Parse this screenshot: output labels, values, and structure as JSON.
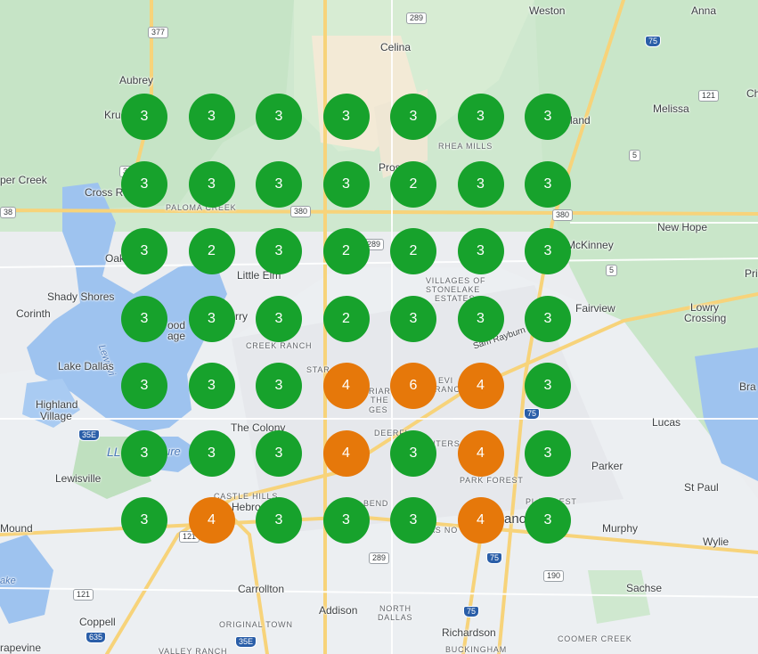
{
  "map": {
    "place_labels": [
      {
        "name": "Weston"
      },
      {
        "name": "Anna"
      },
      {
        "name": "Celina"
      },
      {
        "name": "Aubrey"
      },
      {
        "name": "Krug"
      },
      {
        "name": "land"
      },
      {
        "name": "Melissa"
      },
      {
        "name": "RHEA MILLS"
      },
      {
        "name": "per Creek"
      },
      {
        "name": "Cross Ro"
      },
      {
        "name": "Pros"
      },
      {
        "name": "PALOMA CREEK"
      },
      {
        "name": "New Hope"
      },
      {
        "name": "McKinney"
      },
      {
        "name": "Oak"
      },
      {
        "name": "Little Elm"
      },
      {
        "name": "VILLAGES OF"
      },
      {
        "name": "STONELAKE"
      },
      {
        "name": "ESTATES"
      },
      {
        "name": "Shady Shores"
      },
      {
        "name": "Corinth"
      },
      {
        "name": "Fairview"
      },
      {
        "name": "Lowry"
      },
      {
        "name": "Crossing"
      },
      {
        "name": "ood"
      },
      {
        "name": "age"
      },
      {
        "name": "rry"
      },
      {
        "name": "CREEK RANCH"
      },
      {
        "name": "Lewisvi"
      },
      {
        "name": "Sam Rayburn T"
      },
      {
        "name": "Lake Dallas"
      },
      {
        "name": "STAR"
      },
      {
        "name": "Bra"
      },
      {
        "name": "Highland"
      },
      {
        "name": "Village"
      },
      {
        "name": "Lucas"
      },
      {
        "name": "The Colony"
      },
      {
        "name": "DEERFI"
      },
      {
        "name": "NTERS"
      },
      {
        "name": "LL"
      },
      {
        "name": "ure"
      },
      {
        "name": "Lewisville"
      },
      {
        "name": "Parker"
      },
      {
        "name": "PARK FOREST"
      },
      {
        "name": "CASTLE HILLS"
      },
      {
        "name": "Hebro"
      },
      {
        "name": "BEND"
      },
      {
        "name": "St Paul"
      },
      {
        "name": "PLANO EST"
      },
      {
        "name": "ano"
      },
      {
        "name": "Mound"
      },
      {
        "name": "Murphy"
      },
      {
        "name": "Wylie"
      },
      {
        "name": "ake"
      },
      {
        "name": "Carrollton"
      },
      {
        "name": "Sachse"
      },
      {
        "name": "Addison"
      },
      {
        "name": "NORTH"
      },
      {
        "name": "DALLAS"
      },
      {
        "name": "Coppell"
      },
      {
        "name": "ORIGINAL TOWN"
      },
      {
        "name": "Richardson"
      },
      {
        "name": "COOMER CREEK"
      },
      {
        "name": "VALLEY RANCH"
      },
      {
        "name": "BUCKINGHAM"
      },
      {
        "name": "rapevine"
      },
      {
        "name": "Pri"
      },
      {
        "name": "Ch"
      },
      {
        "name": "AS NO"
      },
      {
        "name": "RIAR"
      },
      {
        "name": "THE"
      },
      {
        "name": "GES"
      },
      {
        "name": "EVI"
      },
      {
        "name": "RANC"
      }
    ],
    "route_shields": [
      {
        "label": "377"
      },
      {
        "label": "289"
      },
      {
        "label": "75"
      },
      {
        "label": "121"
      },
      {
        "label": "5"
      },
      {
        "label": "380"
      },
      {
        "label": "380"
      },
      {
        "label": "289"
      },
      {
        "label": "5"
      },
      {
        "label": "75"
      },
      {
        "label": "35E"
      },
      {
        "label": "121"
      },
      {
        "label": "289"
      },
      {
        "label": "75"
      },
      {
        "label": "190"
      },
      {
        "label": "121"
      },
      {
        "label": "75"
      },
      {
        "label": "635"
      },
      {
        "label": "35E"
      },
      {
        "label": "38"
      },
      {
        "label": "38"
      }
    ],
    "grid_colors": {
      "good": "#17a22c",
      "mid": "#e6780a"
    },
    "grid_ranks": [
      [
        3,
        3,
        3,
        3,
        3,
        3,
        3
      ],
      [
        3,
        3,
        3,
        3,
        2,
        3,
        3
      ],
      [
        3,
        2,
        3,
        2,
        2,
        3,
        3
      ],
      [
        3,
        3,
        3,
        2,
        3,
        3,
        3
      ],
      [
        3,
        3,
        3,
        4,
        6,
        4,
        3
      ],
      [
        3,
        3,
        3,
        4,
        3,
        4,
        3
      ],
      [
        3,
        4,
        3,
        3,
        3,
        4,
        3
      ]
    ]
  }
}
